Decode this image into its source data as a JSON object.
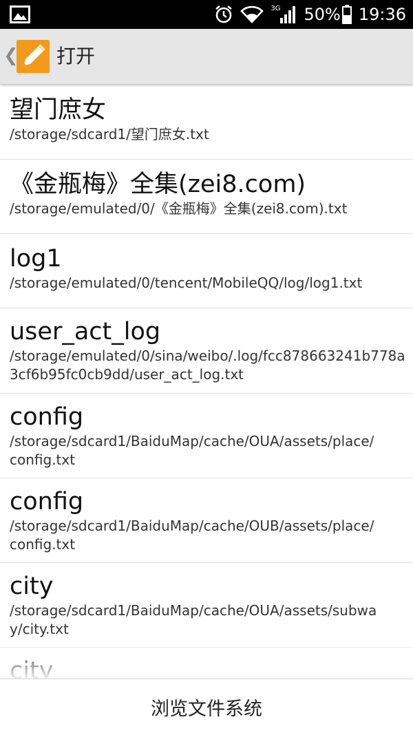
{
  "status_bar": {
    "network": "3G",
    "battery": "50%",
    "time": "19:36"
  },
  "action_bar": {
    "title": "打开"
  },
  "files": [
    {
      "name": "望门庶女",
      "path": "/storage/sdcard1/望门庶女.txt"
    },
    {
      "name": "《金瓶梅》全集(zei8.com)",
      "path": "/storage/emulated/0/《金瓶梅》全集(zei8.com).txt"
    },
    {
      "name": "log1",
      "path": "/storage/emulated/0/tencent/MobileQQ/log/log1.txt"
    },
    {
      "name": "user_act_log",
      "path": "/storage/emulated/0/sina/weibo/.log/fcc878663241b778a3cf6b95fc0cb9dd/user_act_log.txt"
    },
    {
      "name": "config",
      "path": "/storage/sdcard1/BaiduMap/cache/OUA/assets/place/config.txt"
    },
    {
      "name": "config",
      "path": "/storage/sdcard1/BaiduMap/cache/OUB/assets/place/config.txt"
    },
    {
      "name": "city",
      "path": "/storage/sdcard1/BaiduMap/cache/OUA/assets/subway/city.txt"
    },
    {
      "name": "city",
      "path": ""
    }
  ],
  "bottom_button": {
    "label": "浏览文件系统"
  },
  "colors": {
    "action_bar_bg": "#e6e6e6",
    "app_icon": "#f39a1c",
    "status_bar_bg": "#000000"
  },
  "icons": {
    "status_left": "image-notification-icon",
    "alarm": "alarm-clock-icon",
    "wifi": "wifi-icon",
    "signal": "cell-signal-icon",
    "battery": "battery-icon",
    "app": "pencil-app-icon"
  }
}
